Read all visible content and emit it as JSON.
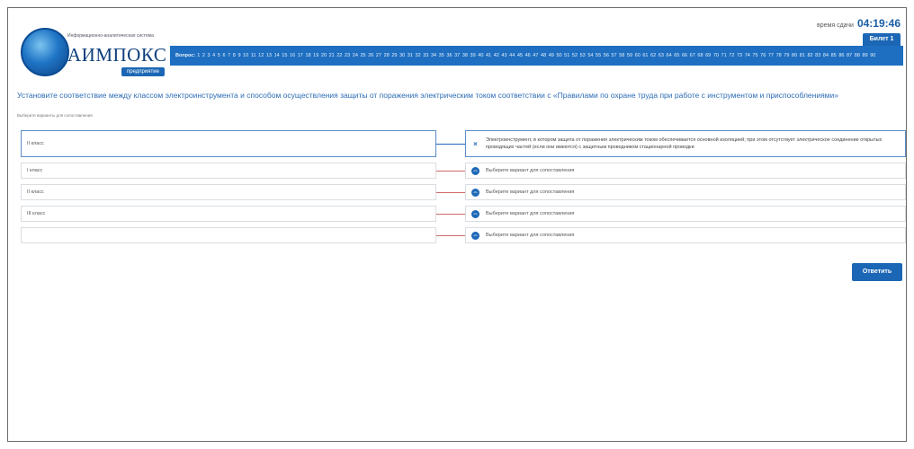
{
  "header": {
    "timer_label": "время сдачи",
    "timer_value": "04:19:46",
    "ticket_label": "Билет 1",
    "questions_label": "Вопрос:",
    "question_numbers": [
      "1",
      "2",
      "3",
      "4",
      "5",
      "6",
      "7",
      "8",
      "9",
      "10",
      "11",
      "12",
      "13",
      "14",
      "15",
      "16",
      "17",
      "18",
      "19",
      "20",
      "21",
      "22",
      "23",
      "24",
      "25",
      "26",
      "27",
      "28",
      "29",
      "30",
      "31",
      "32",
      "33",
      "34",
      "35",
      "36",
      "37",
      "38",
      "39",
      "40",
      "41",
      "42",
      "43",
      "44",
      "45",
      "46",
      "47",
      "48",
      "49",
      "50",
      "51",
      "52",
      "53",
      "54",
      "55",
      "56",
      "57",
      "58",
      "59",
      "60",
      "61",
      "62",
      "63",
      "64",
      "65",
      "66",
      "67",
      "68",
      "69",
      "70",
      "71",
      "72",
      "73",
      "74",
      "75",
      "76",
      "77",
      "78",
      "79",
      "80",
      "81",
      "82",
      "83",
      "84",
      "85",
      "86",
      "87",
      "88",
      "89",
      "90"
    ]
  },
  "logo": {
    "tagline": "Информационно-аналитическая система",
    "name": "АИМПОКС",
    "badge": "предприятие"
  },
  "question": {
    "text": "Установите соответствие между классом электроинструмента и способом осуществления защиты от поражения электрическим током соответствии с «Правилами по охране труда при работе с инструментом и приспособлениями»",
    "hint": "Выберите варианты для сопоставления"
  },
  "left_items": [
    {
      "label": "II класс"
    },
    {
      "label": "I класс"
    },
    {
      "label": "II класс"
    },
    {
      "label": "III класс"
    },
    {
      "label": ""
    }
  ],
  "right_items": [
    {
      "icon": "×",
      "label": "Электроинструмент, в котором защита от поражения электрическим током обеспечивается основной изоляцией; при этом отсутствует электрическое соединение открытых проводящих частей (если они имеются) с защитным проводником стационарной проводки"
    },
    {
      "icon": "⇔",
      "label": "Выберите вариант для сопоставления"
    },
    {
      "icon": "⇔",
      "label": "Выберите вариант для сопоставления"
    },
    {
      "icon": "⇔",
      "label": "Выберите вариант для сопоставления"
    },
    {
      "icon": "⇔",
      "label": "Выберите вариант для сопоставления"
    }
  ],
  "actions": {
    "answer": "Ответить"
  },
  "colors": {
    "accent": "#1c67b5",
    "link_line": "#d06a6a",
    "question_text": "#2c6cb5"
  }
}
